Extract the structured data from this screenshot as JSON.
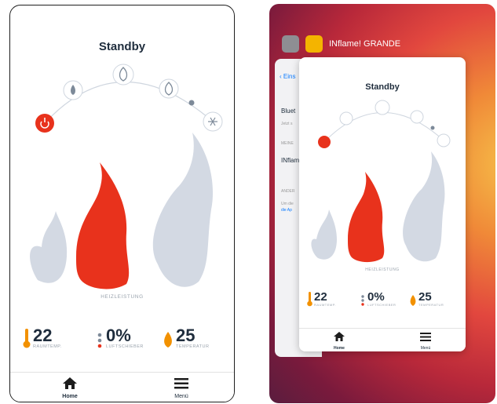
{
  "left_screen": {
    "title": "Standby",
    "heizleistung_label": "HEIZLEISTUNG",
    "stats": [
      {
        "value": "22",
        "label": "RAUMTEMP."
      },
      {
        "value": "0%",
        "label": "LUFTSCHIEBER"
      },
      {
        "value": "25",
        "label": "TEMPERATUR"
      }
    ],
    "tabs": [
      {
        "label": "Home",
        "icon": "home-icon"
      },
      {
        "label": "Menü",
        "icon": "menu-icon"
      }
    ],
    "arc_buttons": [
      "power-icon",
      "flame-low-icon",
      "flame-medium-icon",
      "flame-high-icon",
      "snowflake-icon"
    ]
  },
  "right_screen": {
    "app_switcher_title": "INflame! GRANDE",
    "settings_back": "Eins",
    "settings_rows": [
      "Bluet",
      "Jetzt s",
      "MEINE",
      "INflam",
      "ANDER",
      "Um die",
      "die Ap"
    ],
    "mini_app": {
      "title": "Standby",
      "heizleistung_label": "HEIZLEISTUNG",
      "stats": [
        {
          "value": "22",
          "label": "RAUMTEMP."
        },
        {
          "value": "0%",
          "label": "LUFTSCHIEBER"
        },
        {
          "value": "25",
          "label": "TEMPERATUR"
        }
      ],
      "tabs": [
        {
          "label": "Home"
        },
        {
          "label": "Menü"
        }
      ]
    }
  },
  "colors": {
    "flame_red": "#e8321c",
    "flame_grey": "#d3d9e3",
    "text_dark": "#1f2d3d",
    "text_grey": "#9aa3ad",
    "temp_orange": "#f29100"
  }
}
